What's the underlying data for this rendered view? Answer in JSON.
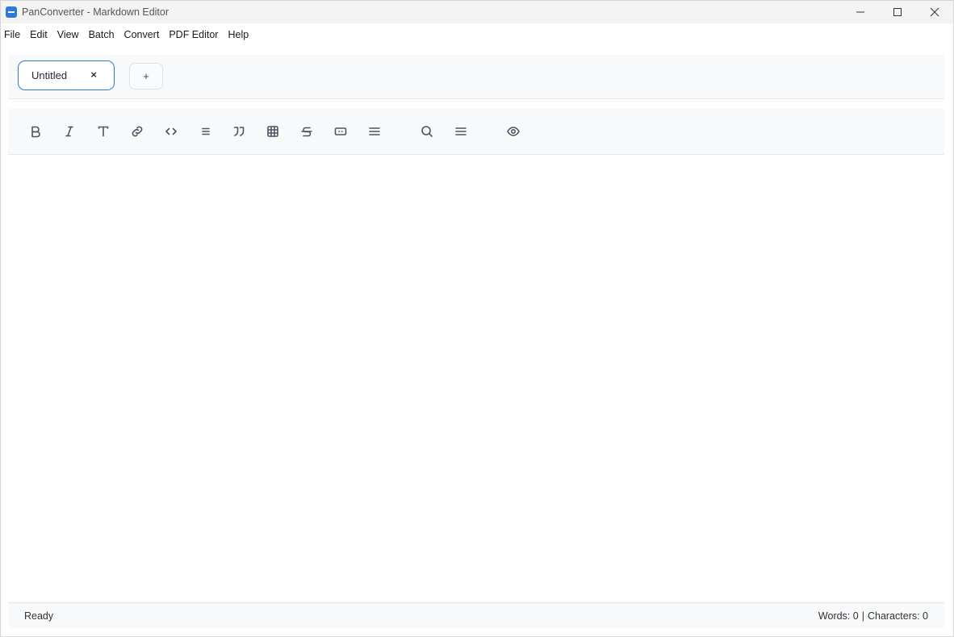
{
  "window": {
    "title": "PanConverter - Markdown Editor"
  },
  "menu": [
    "File",
    "Edit",
    "View",
    "Batch",
    "Convert",
    "PDF Editor",
    "Help"
  ],
  "tabs": [
    {
      "label": "Untitled",
      "close": "×"
    }
  ],
  "add_tab_label": "+",
  "toolbar": {
    "items": [
      "bold",
      "italic",
      "heading",
      "link",
      "code",
      "list",
      "quote",
      "table",
      "strikethrough",
      "inline-code",
      "align",
      "search",
      "menu",
      "preview"
    ]
  },
  "editor": {
    "content": ""
  },
  "status": {
    "state": "Ready",
    "words": "Words: 0",
    "separator": "|",
    "characters": "Characters: 0"
  },
  "colors": {
    "accent": "#2f7ad6"
  }
}
